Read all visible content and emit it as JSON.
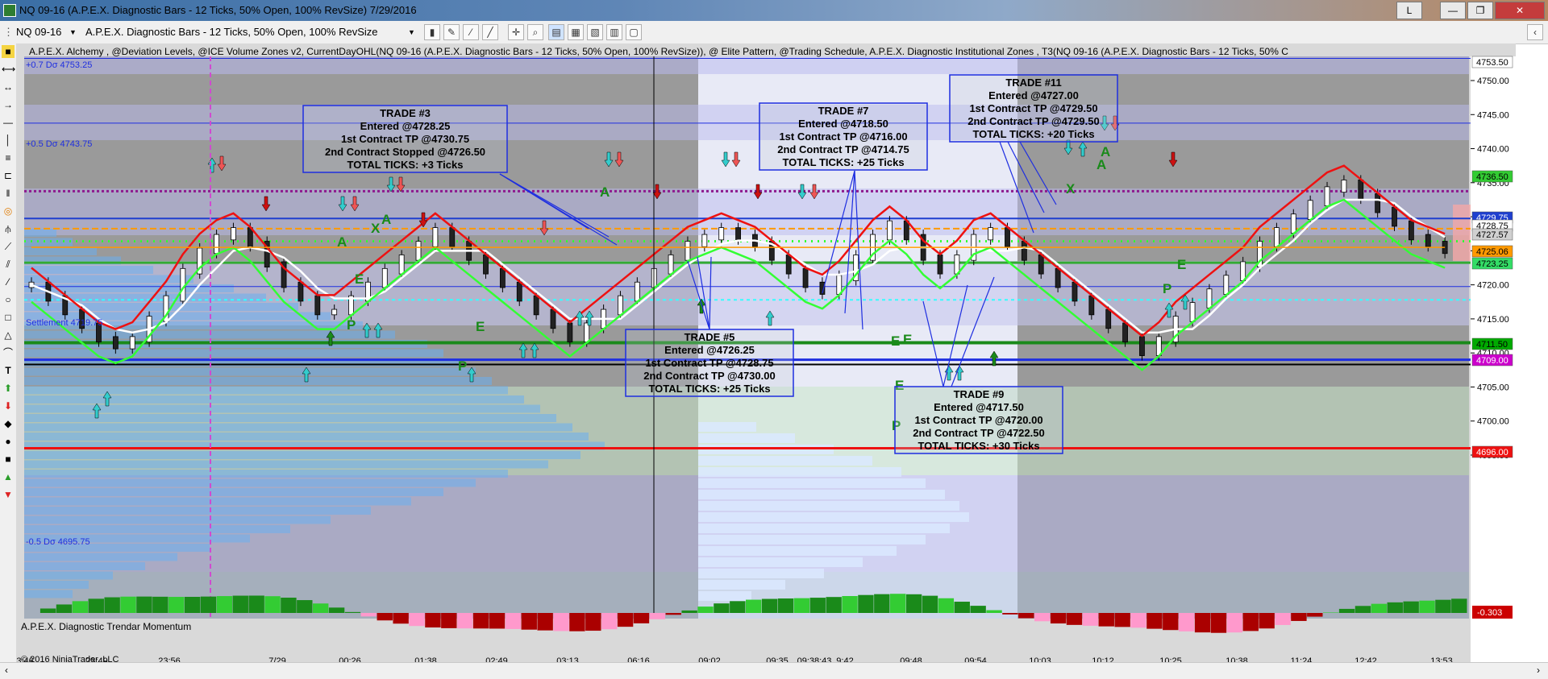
{
  "window": {
    "title": "NQ 09-16 (A.P.E.X. Diagnostic Bars - 12 Ticks, 50% Open, 100% RevSize)  7/29/2016",
    "min_label": "—",
    "max_label": "❐",
    "close_label": "✕",
    "layout_button": "L"
  },
  "toolbar": {
    "instrument": "NQ 09-16",
    "bar_type": "A.P.E.X. Diagnostic Bars - 12 Ticks, 50% Open, 100% RevSize"
  },
  "chart": {
    "indicator_header": "A.P.E.X. Alchemy , @Deviation Levels, @ICE Volume Zones v2, CurrentDayOHL(NQ 09-16 (A.P.E.X. Diagnostic Bars - 12 Ticks, 50% Open, 100% RevSize)), @ Elite Pattern, @Trading Schedule, A.P.E.X. Diagnostic Institutional Zones , T3(NQ 09-16 (A.P.E.X. Diagnostic Bars - 12 Ticks, 50% C",
    "dev_labels": {
      "plus07": "+0.7 Dσ 4753.25",
      "plus05": "+0.5 Dσ 4743.75",
      "settlement": "Settlement 4719.75",
      "minus05": "-0.5 Dσ 4695.75"
    },
    "copyright": "© 2016 NinjaTrader, LLC",
    "panel2_label": "A.P.E.X. Diagnostic Trendar Momentum",
    "price_ticks": [
      "4750.00",
      "4745.00",
      "4740.00",
      "4735.00",
      "4730.00",
      "4725.00",
      "4720.00",
      "4715.00",
      "4710.00",
      "4705.00",
      "4700.00",
      "4695.00"
    ],
    "price_tags": [
      {
        "label": "4753.50",
        "color": "#ffffff",
        "text": "#000000"
      },
      {
        "label": "4736.50",
        "color": "#33cc33",
        "text": "#000000"
      },
      {
        "label": "4729.75",
        "color": "#1f3fcf",
        "text": "#ffffff"
      },
      {
        "label": "4728.75",
        "color": "#ffffff",
        "text": "#000000"
      },
      {
        "label": "4727.57",
        "color": "#d0d0d0",
        "text": "#000000"
      },
      {
        "label": "4725.06",
        "color": "#ff9900",
        "text": "#000000"
      },
      {
        "label": "4723.25",
        "color": "#33dd66",
        "text": "#000000"
      },
      {
        "label": "4711.50",
        "color": "#00aa00",
        "text": "#000000"
      },
      {
        "label": "4709.00",
        "color": "#cc00cc",
        "text": "#ffffff"
      },
      {
        "label": "4696.00",
        "color": "#ee1111",
        "text": "#ffffff"
      }
    ],
    "momentum_ticks": [
      "0"
    ],
    "momentum_tag": "-0.303",
    "time_labels": [
      "23:46",
      "23:49",
      "23:56",
      "7/29",
      "00:26",
      "01:38",
      "02:49",
      "03:13",
      "06:16",
      "09:02",
      "09:35",
      "09:38:43",
      "9:42",
      "09:48",
      "09:54",
      "10:03",
      "10:12",
      "10:25",
      "10:38",
      "11:24",
      "12:42",
      "13:53"
    ],
    "trades": [
      {
        "id": "t3",
        "title": "TRADE #3",
        "lines": [
          "Entered @4728.25",
          "1st Contract TP @4730.75",
          "2nd Contract Stopped @4726.50",
          "TOTAL TICKS: +3 Ticks"
        ]
      },
      {
        "id": "t5",
        "title": "TRADE #5",
        "lines": [
          "Entered @4726.25",
          "1st Contract TP @4728.75",
          "2nd Contract TP @4730.00",
          "TOTAL TICKS: +25 Ticks"
        ]
      },
      {
        "id": "t7",
        "title": "TRADE #7",
        "lines": [
          "Entered @4718.50",
          "1st Contract TP @4716.00",
          "2nd Contract TP @4714.75",
          "TOTAL TICKS: +25 Ticks"
        ]
      },
      {
        "id": "t9",
        "title": "TRADE #9",
        "lines": [
          "Entered @4717.50",
          "1st Contract TP @4720.00",
          "2nd Contract TP @4722.50",
          "TOTAL TICKS: +30 Ticks"
        ]
      },
      {
        "id": "t11",
        "title": "TRADE #11",
        "lines": [
          "Entered @4727.00",
          "1st Contract TP @4729.50",
          "2nd Contract TP @4729.50",
          "TOTAL TICKS: +20 Ticks"
        ]
      }
    ],
    "pattern_letters": [
      "A",
      "X",
      "A",
      "P",
      "E",
      "A",
      "P",
      "E",
      "A",
      "E",
      "P",
      "E",
      "X",
      "A",
      "E",
      "P",
      "E"
    ]
  }
}
